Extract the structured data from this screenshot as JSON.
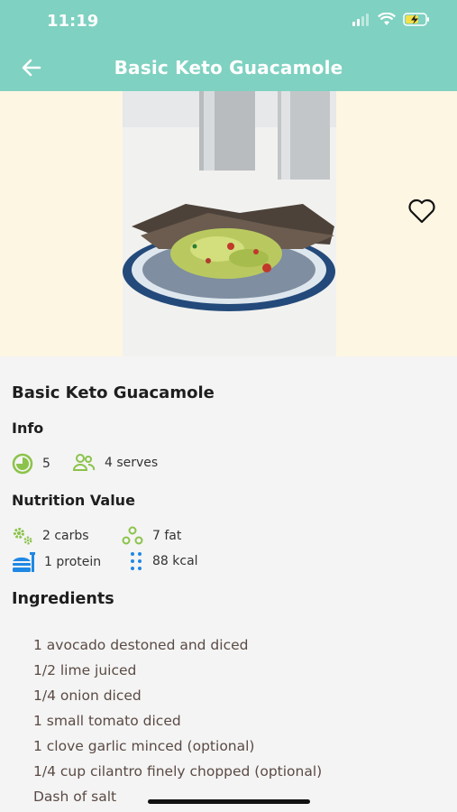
{
  "status_bar": {
    "time": "11:19"
  },
  "header": {
    "title": "Basic Keto Guacamole"
  },
  "recipe": {
    "name": "Basic Keto Guacamole",
    "info_title": "Info",
    "time_value": "5",
    "serves": "4 serves",
    "nutrition_title": "Nutrition Value",
    "carbs": "2 carbs",
    "fat": "7 fat",
    "protein": "1 protein",
    "kcal": "88 kcal",
    "ingredients_title": "Ingredients",
    "ingredients": [
      "1 avocado destoned and diced",
      "1/2 lime juiced",
      "1/4 onion diced",
      "1 small tomato diced",
      "1 clove garlic minced (optional)",
      "1/4 cup cilantro finely chopped (optional)",
      "Dash of salt"
    ]
  },
  "colors": {
    "header": "#7fd1c1",
    "accent_green": "#8bc34a",
    "accent_blue": "#1e88e5"
  }
}
